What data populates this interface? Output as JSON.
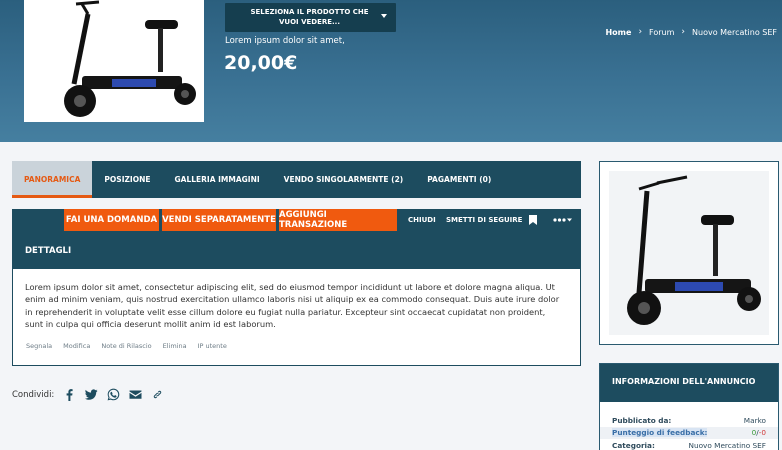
{
  "header": {
    "variant_select": "SELEZIONA IL PRODOTTO CHE VUOI VEDERE...",
    "short_description": "Lorem ipsum dolor sit amet,",
    "price": "20,00€",
    "breadcrumb": [
      "Home",
      "Forum",
      "Nuovo Mercatino SEF"
    ]
  },
  "tabs": [
    {
      "label": "PANORAMICA",
      "active": true
    },
    {
      "label": "POSIZIONE"
    },
    {
      "label": "GALLERIA IMMAGINI"
    },
    {
      "label": "VENDO SINGOLARMENTE (2)"
    },
    {
      "label": "PAGAMENTI (0)"
    }
  ],
  "actions": {
    "ask": "FAI UNA DOMANDA",
    "sell_separately": "VENDI SEPARATAMENTE",
    "add_transaction": "AGGIUNGI TRANSAZIONE",
    "close": "CHIUDI",
    "unfollow": "SMETTI DI SEGUIRE"
  },
  "details": {
    "title": "DETTAGLI",
    "body": "Lorem ipsum dolor sit amet, consectetur adipiscing elit, sed do eiusmod tempor incididunt ut labore et dolore magna aliqua. Ut enim ad minim veniam, quis nostrud exercitation ullamco laboris nisi ut aliquip ex ea commodo consequat. Duis aute irure dolor in reprehenderit in voluptate velit esse cillum dolore eu fugiat nulla pariatur. Excepteur sint occaecat cupidatat non proident, sunt in culpa qui officia deserunt mollit anim id est laborum.",
    "links": [
      "Segnala",
      "Modifica",
      "Note di Rilascio",
      "Elimina",
      "IP utente"
    ]
  },
  "share": {
    "label": "Condividi:"
  },
  "info": {
    "title": "INFORMAZIONI DELL'ANNUNCIO",
    "published_by_label": "Pubblicato da:",
    "published_by": "Marko",
    "feedback_label": "Punteggio di feedback:",
    "feedback_pos": "0",
    "feedback_sep": "/",
    "feedback_neg": "-0",
    "category_label": "Categoria:",
    "category": "Nuovo Mercatino SEF"
  },
  "colors": {
    "accent": "#f05a0f",
    "dark": "#1d4c5f"
  }
}
